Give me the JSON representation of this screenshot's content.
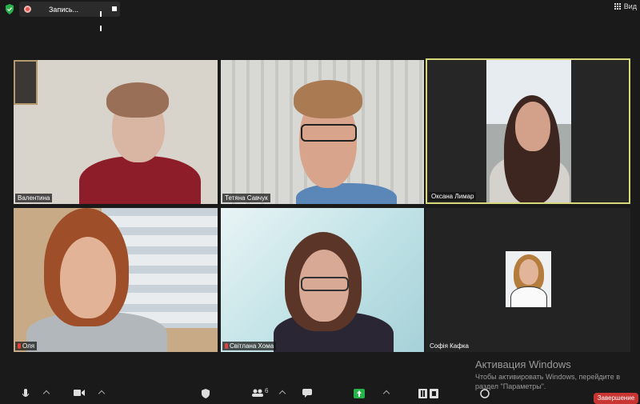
{
  "recording": {
    "label": "Запись..."
  },
  "view": {
    "label": "Вид"
  },
  "participants": [
    {
      "name": "Валентина",
      "muted": false,
      "active_speaker": false
    },
    {
      "name": "Тетяна Савчук",
      "muted": false,
      "active_speaker": false
    },
    {
      "name": "Оксана Лимар",
      "muted": false,
      "active_speaker": true
    },
    {
      "name": "Оля",
      "muted": true,
      "active_speaker": false
    },
    {
      "name": "Світлана Хома",
      "muted": true,
      "active_speaker": false
    },
    {
      "name": "Софія Кафка",
      "muted": false,
      "active_speaker": false
    }
  ],
  "toolbar": {
    "participants_count": "6",
    "end_label": "Завершение"
  },
  "activation": {
    "title": "Активация Windows",
    "text": "Чтобы активировать Windows, перейдите в раздел \"Параметры\"."
  },
  "colors": {
    "active_border": "#d6d87a",
    "end_button": "#c83532"
  },
  "icons": [
    "shield-icon",
    "record-icon",
    "pause-icon",
    "stop-icon",
    "grid-icon",
    "microphone-icon",
    "video-icon",
    "security-icon",
    "participants-icon",
    "chat-icon",
    "share-screen-icon",
    "pause-recording-icon",
    "reactions-icon"
  ]
}
